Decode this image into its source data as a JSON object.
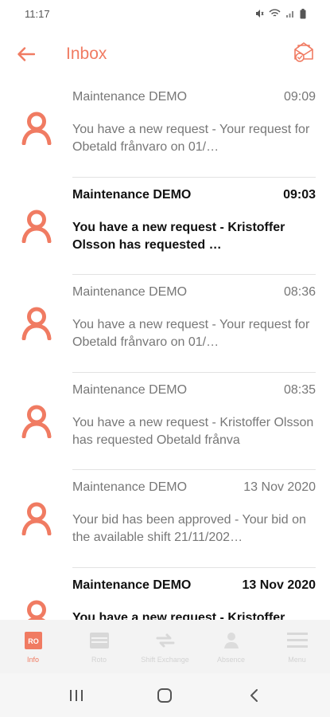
{
  "status_bar": {
    "time": "11:17"
  },
  "header": {
    "title": "Inbox"
  },
  "messages": [
    {
      "sender": "Maintenance DEMO",
      "time": "09:09",
      "preview": "You have a new request - Your request for Obetald frånvaro on 01/…",
      "unread": false
    },
    {
      "sender": "Maintenance DEMO",
      "time": "09:03",
      "preview": "You have a new request - Kristoffer Olsson has requested …",
      "unread": true
    },
    {
      "sender": "Maintenance DEMO",
      "time": "08:36",
      "preview": "You have a new request - Your request for Obetald frånvaro on 01/…",
      "unread": false
    },
    {
      "sender": "Maintenance DEMO",
      "time": "08:35",
      "preview": "You have a new request - Kristoffer Olsson has requested Obetald frånva",
      "unread": false
    },
    {
      "sender": "Maintenance DEMO",
      "time": "13 Nov 2020",
      "preview": "Your bid has been approved - Your bid on the available shift 21/11/202…",
      "unread": false
    },
    {
      "sender": "Maintenance DEMO",
      "time": "13 Nov 2020",
      "preview": "You have a new request - Kristoffer",
      "unread": true
    }
  ],
  "tabs": [
    {
      "label": "Info",
      "icon": "info-icon",
      "active": true
    },
    {
      "label": "Roto",
      "icon": "calendar-icon",
      "active": false
    },
    {
      "label": "Shift Exchange",
      "icon": "exchange-icon",
      "active": false
    },
    {
      "label": "Absence",
      "icon": "absence-icon",
      "active": false
    },
    {
      "label": "Menu",
      "icon": "menu-icon",
      "active": false
    }
  ],
  "colors": {
    "accent": "#f07b62",
    "text_unread": "#111111",
    "text_read": "#777777",
    "tab_inactive": "#d3d3d3"
  }
}
